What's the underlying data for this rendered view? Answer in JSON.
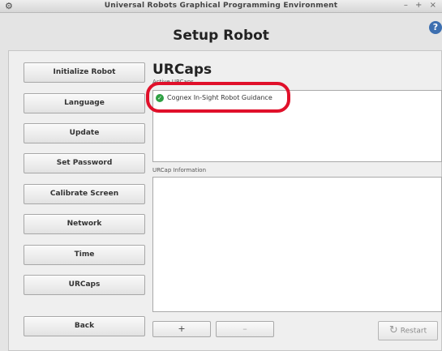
{
  "window": {
    "title": "Universal Robots Graphical Programming Environment",
    "controls": "– + ×",
    "app_icon": "robot-icon"
  },
  "header": {
    "title": "Setup Robot",
    "help_icon": "help-icon",
    "help_glyph": "?"
  },
  "sidebar": {
    "items": [
      {
        "label": "Initialize Robot"
      },
      {
        "label": "Language"
      },
      {
        "label": "Update"
      },
      {
        "label": "Set Password"
      },
      {
        "label": "Calibrate Screen"
      },
      {
        "label": "Network"
      },
      {
        "label": "Time"
      },
      {
        "label": "URCaps"
      }
    ],
    "back_label": "Back"
  },
  "main": {
    "section_title": "URCaps",
    "active_label": "Active URCaps",
    "urcaps": [
      {
        "name": "Cognex In-Sight Robot Guidance",
        "status": "active",
        "status_icon": "check-icon"
      }
    ],
    "info_label": "URCap Information",
    "add_glyph": "+",
    "remove_glyph": "–",
    "restart_label": "Restart",
    "restart_glyph": "↻"
  },
  "colors": {
    "highlight": "#e0102a",
    "active_check": "#2ea043",
    "help": "#3d6fb0"
  }
}
